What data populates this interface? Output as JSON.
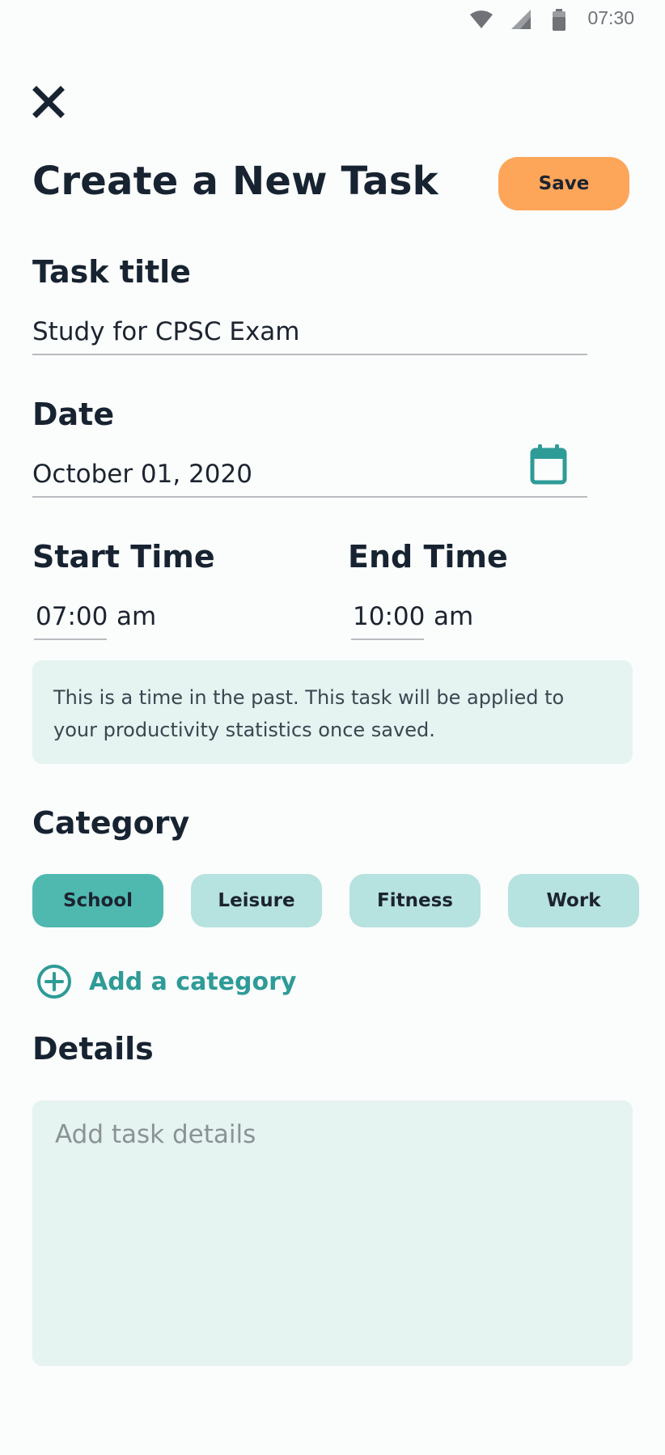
{
  "status_bar": {
    "time": "07:30",
    "icons": [
      "wifi-icon",
      "signal-icon",
      "battery-icon"
    ]
  },
  "header": {
    "close_icon": "close-icon",
    "title": "Create a New Task",
    "save_label": "Save"
  },
  "form": {
    "task_title_label": "Task title",
    "task_title_value": "Study for CPSC Exam",
    "date_label": "Date",
    "date_value": "October 01, 2020",
    "date_icon": "calendar-icon",
    "start_time_label": "Start Time",
    "start_time_value": "07:00",
    "start_time_period": "am",
    "end_time_label": "End Time",
    "end_time_value": "10:00",
    "end_time_period": "am",
    "notice": "This is a time in the past. This task will be applied to your productivity statistics once saved."
  },
  "category": {
    "label": "Category",
    "items": [
      {
        "label": "School",
        "selected": true
      },
      {
        "label": "Leisure",
        "selected": false
      },
      {
        "label": "Fitness",
        "selected": false
      },
      {
        "label": "Work",
        "selected": false
      }
    ],
    "add_label": "Add a category",
    "add_icon": "plus-circle-icon"
  },
  "details": {
    "label": "Details",
    "placeholder": "Add task details"
  },
  "colors": {
    "accent_orange": "#fda65a",
    "teal_selected": "#4fb9b0",
    "teal_light": "#b6e2df",
    "teal_text": "#2e9b97",
    "panel_bg": "#e5f3f1"
  }
}
